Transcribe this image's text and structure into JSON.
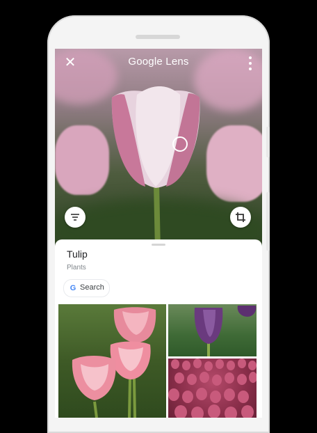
{
  "app": {
    "title": "Google Lens"
  },
  "icons": {
    "close": "close-icon",
    "more": "more-vert-icon",
    "focus": "focus-ring-icon",
    "filter": "filter-icon",
    "crop": "crop-icon",
    "google": "google-g-icon"
  },
  "result": {
    "title": "Tulip",
    "category": "Plants",
    "search_label": "Search",
    "google_glyph": "G"
  },
  "colors": {
    "google_blue": "#4285f4",
    "tulip_pink": "#c9869f"
  }
}
